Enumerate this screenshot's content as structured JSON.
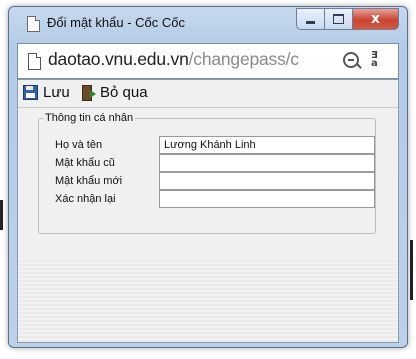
{
  "window": {
    "title": "Đổi mật khẩu - Cốc Cốc",
    "minimize_icon": "minimize-icon",
    "maximize_icon": "maximize-icon",
    "close_label": "x"
  },
  "address_bar": {
    "domain": "daotao.vnu.edu.vn",
    "path": "/changepass/c",
    "page_icon": "page-icon",
    "zoom_icon": "zoom-out-icon",
    "translate_icon": "translate-icon"
  },
  "toolbar": {
    "save_label": "Lưu",
    "cancel_label": "Bỏ qua"
  },
  "form": {
    "legend": "Thông tin cá nhân",
    "fields": [
      {
        "label": "Họ và tên",
        "value": "Lương Khánh Linh"
      },
      {
        "label": "Mật khẩu cũ",
        "value": ""
      },
      {
        "label": "Mật khẩu mới",
        "value": ""
      },
      {
        "label": "Xác nhận lại",
        "value": ""
      }
    ]
  },
  "colors": {
    "frame": "#bcd0e8",
    "close_button": "#c9442f",
    "content_bg": "#f0f0f0"
  }
}
